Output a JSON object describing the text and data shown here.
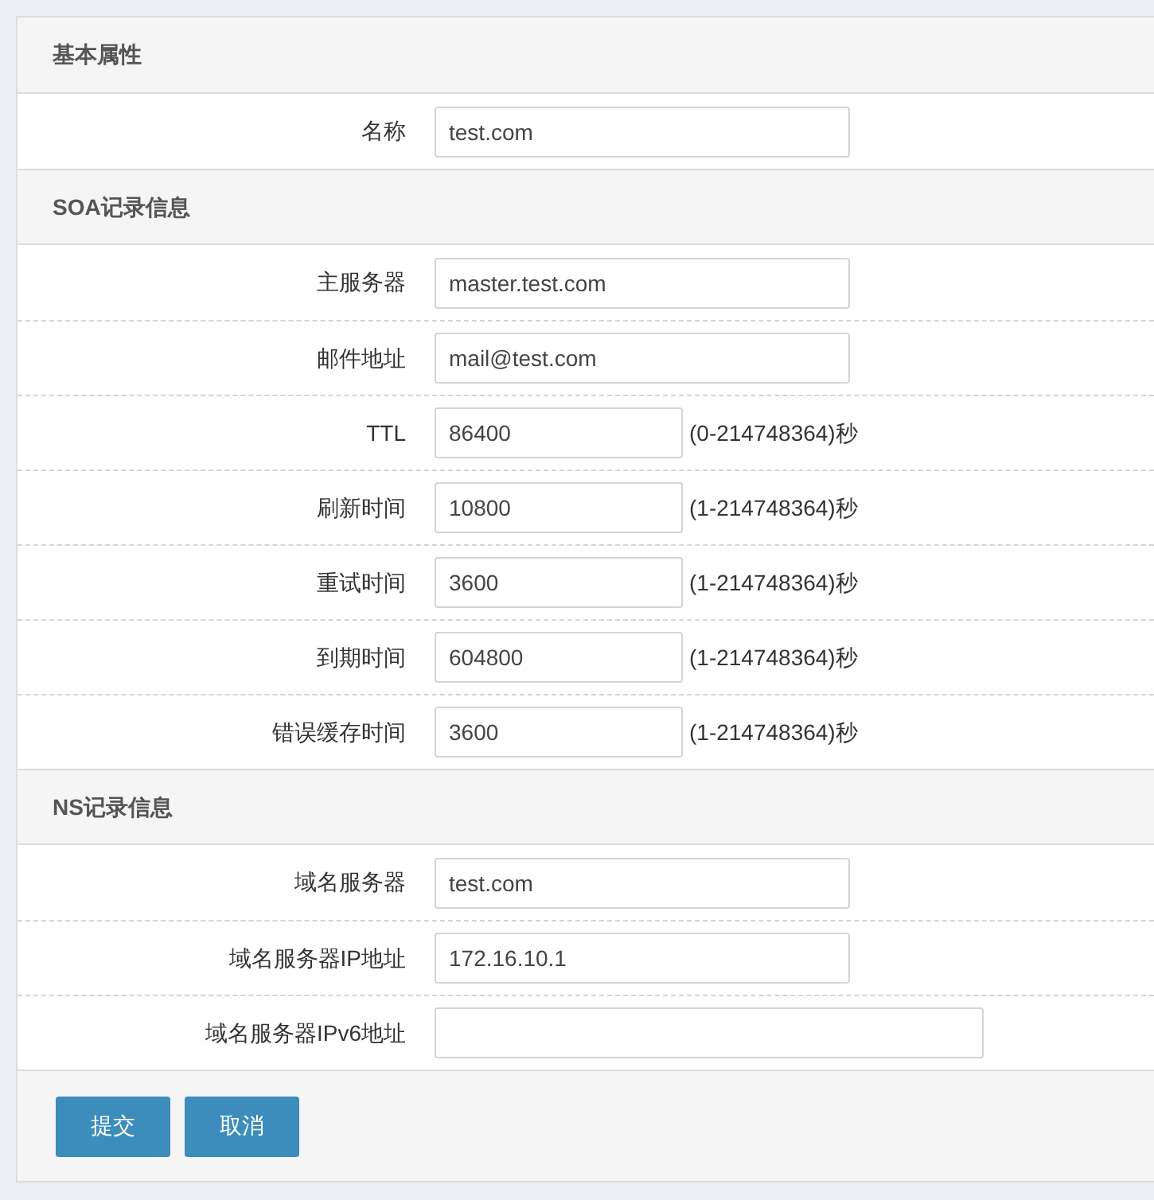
{
  "sections": [
    {
      "title": "基本属性",
      "rows": [
        {
          "label": "名称",
          "value": "test.com",
          "kind": "medium"
        }
      ]
    },
    {
      "title": "SOA记录信息",
      "rows": [
        {
          "label": "主服务器",
          "value": "master.test.com",
          "kind": "medium"
        },
        {
          "label": "邮件地址",
          "value": "mail@test.com",
          "kind": "medium"
        },
        {
          "label": "TTL",
          "value": "86400",
          "kind": "short",
          "hint": "(0-214748364)秒"
        },
        {
          "label": "刷新时间",
          "value": "10800",
          "kind": "short",
          "hint": "(1-214748364)秒"
        },
        {
          "label": "重试时间",
          "value": "3600",
          "kind": "short",
          "hint": "(1-214748364)秒"
        },
        {
          "label": "到期时间",
          "value": "604800",
          "kind": "short",
          "hint": "(1-214748364)秒"
        },
        {
          "label": "错误缓存时间",
          "value": "3600",
          "kind": "short",
          "hint": "(1-214748364)秒"
        }
      ]
    },
    {
      "title": "NS记录信息",
      "rows": [
        {
          "label": "域名服务器",
          "value": "test.com",
          "kind": "medium"
        },
        {
          "label": "域名服务器IP地址",
          "value": "172.16.10.1",
          "kind": "medium"
        },
        {
          "label": "域名服务器IPv6地址",
          "kind": "wide"
        }
      ]
    }
  ],
  "buttons": [
    "提交",
    "取消"
  ]
}
